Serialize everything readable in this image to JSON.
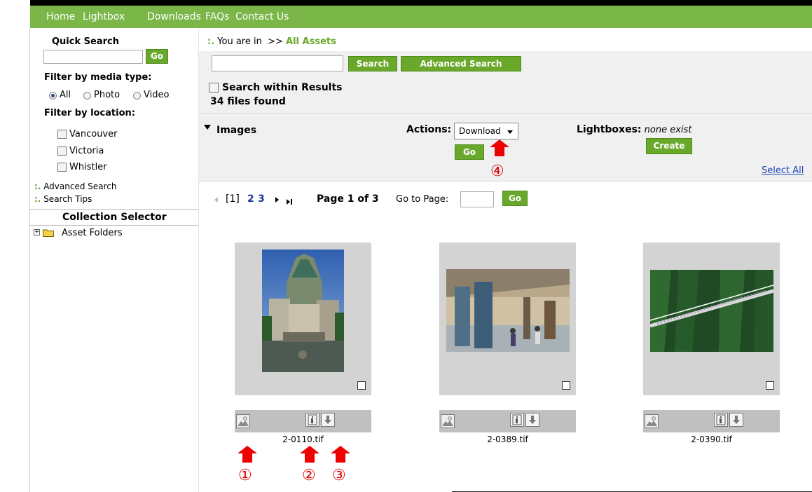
{
  "nav": {
    "items": [
      "Home",
      "Lightbox",
      "Downloads",
      "FAQs",
      "Contact Us"
    ]
  },
  "sidebar": {
    "quick_search_label": "Quick Search",
    "quick_search_value": "",
    "go_label": "Go",
    "filter_media_label": "Filter by media type:",
    "media_options": [
      {
        "label": "All",
        "selected": true
      },
      {
        "label": "Photo",
        "selected": false
      },
      {
        "label": "Video",
        "selected": false
      }
    ],
    "filter_location_label": "Filter by location:",
    "locations": [
      "Vancouver",
      "Victoria",
      "Whistler"
    ],
    "advanced_search_link": "Advanced Search",
    "search_tips_link": "Search Tips",
    "collection_selector_label": "Collection Selector",
    "asset_folders_label": "Asset Folders",
    "expand_symbol": "+"
  },
  "breadcrumb": {
    "bullet": ":.",
    "prefix": "You are in",
    "separator": ">>",
    "current": "All Assets"
  },
  "search": {
    "value": "",
    "search_button": "Search",
    "advanced_button": "Advanced Search",
    "within_results_label": "Search within Results",
    "files_found": "34 files found"
  },
  "toolbar": {
    "images_label": "Images",
    "actions_label": "Actions:",
    "actions_selected": "Download",
    "go_label": "Go",
    "lightboxes_label": "Lightboxes:",
    "lightboxes_value": "none exist",
    "create_label": "Create",
    "select_all_label": "Select All"
  },
  "pagination": {
    "current_page_link": "[1]",
    "page_links": [
      "2",
      "3"
    ],
    "page_info": "Page 1 of 3",
    "goto_label": "Go to Page:",
    "goto_value": "",
    "go_label": "Go"
  },
  "assets": [
    {
      "filename": "2-0110.tif"
    },
    {
      "filename": "2-0389.tif"
    },
    {
      "filename": "2-0390.tif"
    }
  ],
  "annotations": {
    "markers": [
      "①",
      "②",
      "③",
      "④"
    ],
    "color": "#e00000"
  },
  "colors": {
    "nav_green": "#7ab648",
    "button_green": "#6aa82c",
    "panel_gray": "#f0f0f0"
  }
}
